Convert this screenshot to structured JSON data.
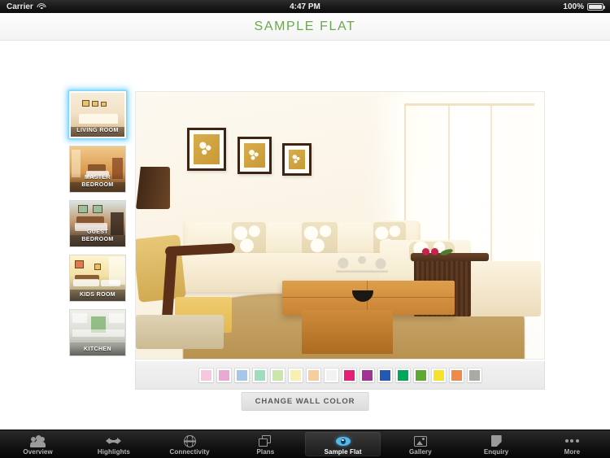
{
  "status_bar": {
    "carrier": "Carrier",
    "wifi_icon": "wifi-icon",
    "time": "4:47 PM",
    "battery_percent": "100%",
    "battery_icon": "battery-full-icon"
  },
  "header": {
    "title": "SAMPLE FLAT",
    "title_color": "#6aa84f"
  },
  "sidebar": {
    "name": "room-thumbnail-list",
    "items": [
      {
        "label": "LIVING ROOM",
        "scene": "sc-living",
        "selected": true
      },
      {
        "label": "MASTER BEDROOM",
        "scene": "sc-master",
        "selected": false
      },
      {
        "label": "GUEST BEDROOM",
        "scene": "sc-guest",
        "selected": false
      },
      {
        "label": "KIDS ROOM",
        "scene": "sc-kids",
        "selected": false
      },
      {
        "label": "KITCHEN",
        "scene": "sc-kitch",
        "selected": false
      }
    ]
  },
  "viewer": {
    "name": "living-room-render",
    "current_room": "LIVING ROOM"
  },
  "palette": {
    "name": "wall-color-palette",
    "swatches": [
      {
        "name": "swatch-light-pink",
        "hex": "#f7c8dd"
      },
      {
        "name": "swatch-pink",
        "hex": "#eaa8d4"
      },
      {
        "name": "swatch-light-blue",
        "hex": "#a8c6e8"
      },
      {
        "name": "swatch-mint",
        "hex": "#9fddbf"
      },
      {
        "name": "swatch-light-green",
        "hex": "#cce5ab"
      },
      {
        "name": "swatch-light-yellow",
        "hex": "#f7f0af"
      },
      {
        "name": "swatch-peach",
        "hex": "#f9cd9b"
      },
      {
        "name": "swatch-white",
        "hex": "#f2f2f0"
      },
      {
        "name": "swatch-magenta",
        "hex": "#e51f76"
      },
      {
        "name": "swatch-purple",
        "hex": "#a23294"
      },
      {
        "name": "swatch-blue",
        "hex": "#2359b0"
      },
      {
        "name": "swatch-green",
        "hex": "#00a65a"
      },
      {
        "name": "swatch-olive-green",
        "hex": "#5fa832"
      },
      {
        "name": "swatch-yellow",
        "hex": "#f6e329"
      },
      {
        "name": "swatch-orange",
        "hex": "#ef8a4c"
      },
      {
        "name": "swatch-grey",
        "hex": "#a8aaa3"
      }
    ]
  },
  "change_wall_color_button": {
    "label": "CHANGE WALL COLOR"
  },
  "tab_bar": {
    "tabs": [
      {
        "label": "Overview",
        "icon": "people-icon",
        "icon_class": "i-overview",
        "active": false
      },
      {
        "label": "Highlights",
        "icon": "arrows-icon",
        "icon_class": "i-highlights",
        "active": false
      },
      {
        "label": "Connectivity",
        "icon": "globe-icon",
        "icon_class": "i-connect",
        "active": false
      },
      {
        "label": "Plans",
        "icon": "layers-icon",
        "icon_class": "i-plans",
        "active": false
      },
      {
        "label": "Sample Flat",
        "icon": "eye-icon",
        "icon_class": "i-sample",
        "active": true
      },
      {
        "label": "Gallery",
        "icon": "photo-icon",
        "icon_class": "i-gallery",
        "active": false
      },
      {
        "label": "Enquiry",
        "icon": "document-icon",
        "icon_class": "i-enquiry",
        "active": false
      },
      {
        "label": "More",
        "icon": "ellipsis-icon",
        "icon_class": "i-more",
        "active": false
      }
    ]
  }
}
